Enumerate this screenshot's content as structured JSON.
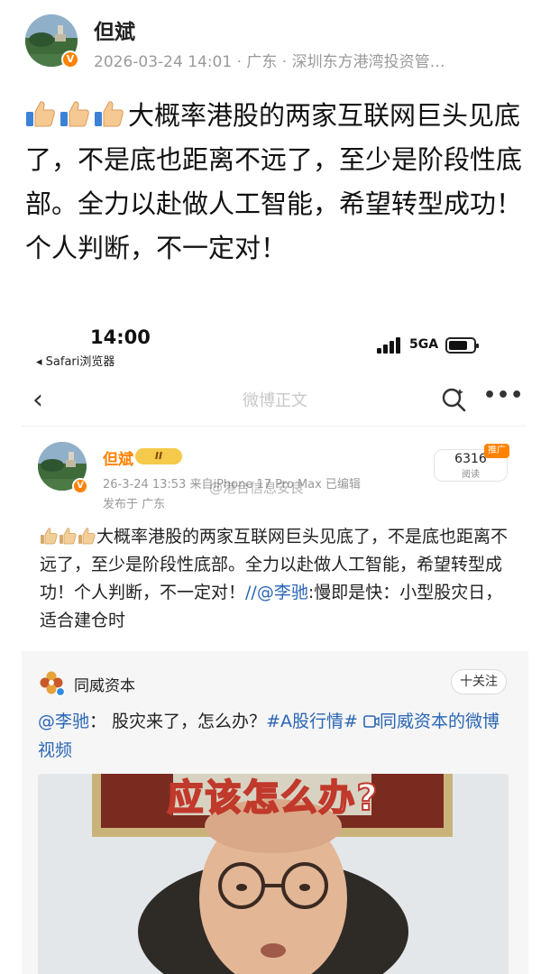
{
  "outer_post": {
    "author": "但斌",
    "verified_badge": "V",
    "meta": "2026-03-24 14:01 · 广东 · 深圳东方港湾投资管…",
    "emoji": "thumbs-up",
    "text": "大概率港股的两家互联网巨头见底了，不是底也距离不远了，至少是阶段性底部。全力以赴做人工智能，希望转型成功！个人判断，不一定对！"
  },
  "screenshot": {
    "status_bar": {
      "time": "14:00",
      "back_app": "◂ Safari浏览器",
      "network": "5GA"
    },
    "nav": {
      "back": "‹",
      "title": "微博正文",
      "more": "•••"
    },
    "post": {
      "author": "但斌",
      "level_badge": "II",
      "meta": "26-3-24 13:53  来自iPhone 17 Pro Max  已编辑",
      "location": "发布于 广东",
      "watermark": "@港台信息安良",
      "read_count": "6316",
      "read_label": "阅读",
      "promo_tag": "推广",
      "text": "大概率港股的两家互联网巨头见底了，不是底也距离不远了，至少是阶段性底部。全力以赴做人工智能，希望转型成功！个人判断，不一定对！",
      "repost_mention": "//@李驰",
      "repost_comment": ":慢即是快：小型股灾日，适合建仓时"
    },
    "repost_card": {
      "author": "同威资本",
      "follow_label": "十关注",
      "mention": "@李驰",
      "text_mid": "： 股灾来了，怎么办？",
      "hashtag": "#A股行情#",
      "video_link": "同威资本的微博视频",
      "video_caption": "应该怎么办?"
    }
  },
  "colors": {
    "accent_orange": "#ff8200",
    "link_blue": "#2a66b5",
    "meta_gray": "#9a9a9a"
  }
}
